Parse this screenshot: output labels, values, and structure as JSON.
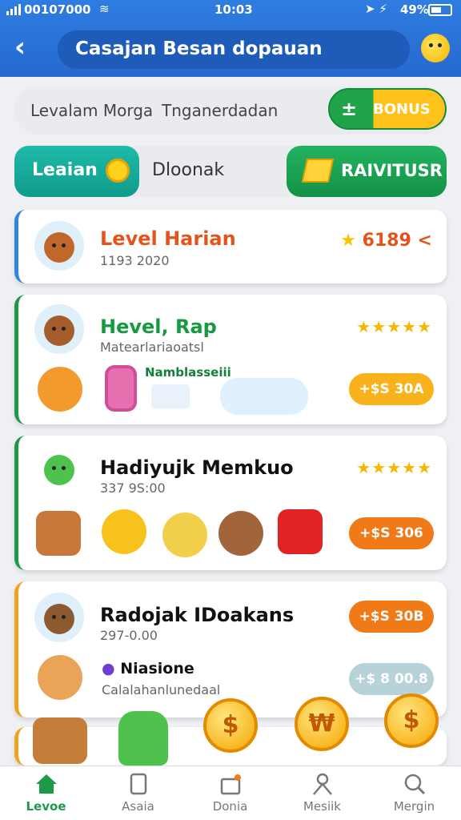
{
  "status_bar": {
    "carrier": "00107000",
    "time": "10:03",
    "battery": "49%"
  },
  "header": {
    "title": "Casajan Besan dopauan"
  },
  "filter_row": {
    "label_left": "Levalam Morga",
    "label_right": "Tnganerdadan",
    "bonus_label": "BONUS"
  },
  "tabs": {
    "active_label": "Leaian",
    "middle_label": "Dloonak",
    "right_label": "RAIVITUSR"
  },
  "cards": [
    {
      "title": "Level Harian",
      "subtitle": "1193 2020",
      "score": "6189 <",
      "title_color": "#e5531b"
    },
    {
      "title": "Hevel, Rap",
      "subtitle": "Matearlariaoatsl",
      "rating": "★★★★★",
      "pill": "+$S 30A",
      "pill_color": "#f8b21c",
      "caption": "Namblasseiii"
    },
    {
      "title": "Hadiyujk Memkuo",
      "subtitle": "337 9S:00",
      "rating": "★★★★★",
      "pill": "+$S 306",
      "pill_color": "#f07a18"
    },
    {
      "title": "Radojak IDoakans",
      "subtitle": "297-0.00",
      "pill": "+$S 30B",
      "pill_color": "#f07a18",
      "item_title": "Niasione",
      "item_subtitle": "Calalahanlunedaal",
      "pill2": "+$ 8 00.8",
      "pill2_color": "#b8d3d8"
    }
  ],
  "floating_buttons": [
    "$",
    "₩",
    "$"
  ],
  "bottom_nav": [
    {
      "label": "Levoe",
      "icon": "home-icon",
      "active": true
    },
    {
      "label": "Asaia",
      "icon": "tablet-icon",
      "active": false
    },
    {
      "label": "Donia",
      "icon": "gift-box-icon",
      "active": false
    },
    {
      "label": "Mesiik",
      "icon": "person-icon",
      "active": false
    },
    {
      "label": "Mergin",
      "icon": "search-icon",
      "active": false
    }
  ]
}
